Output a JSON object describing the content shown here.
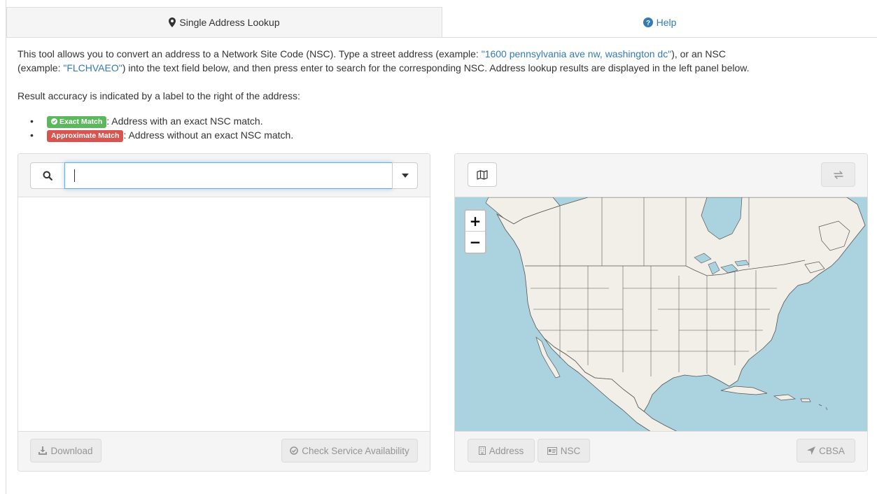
{
  "tabs": [
    {
      "label": "Single Address Lookup",
      "icon": "map-marker-icon",
      "active": true
    },
    {
      "label": "Help",
      "icon": "question-circle-icon",
      "active": false
    }
  ],
  "intro": {
    "t1": "This tool allows you to convert an address to a Network Site Code (NSC). Type a street address (example: ",
    "example_address": "\"1600 pennsylvania ave nw, washington dc\"",
    "t2": "), or an NSC",
    "t3": "(example: ",
    "example_nsc": "\"FLCHVAEO\"",
    "t4": ") into the text field below, and then press enter to search for the corresponding NSC. Address lookup results are displayed in the left panel below."
  },
  "accuracy_text": "Result accuracy is indicated by a label to the right of the address:",
  "legend": [
    {
      "badge": "Exact Match",
      "color": "#5cb85c",
      "desc": ": Address with an exact NSC match."
    },
    {
      "badge": "Approximate Match",
      "color": "#d9534f",
      "desc": ": Address without an exact NSC match."
    }
  ],
  "search": {
    "value": "",
    "placeholder": ""
  },
  "left_footer": {
    "download": "Download",
    "check": "Check Service Availability"
  },
  "map": {
    "zoom_in": "+",
    "zoom_out": "−",
    "water_color": "#aad3df",
    "land_color": "#f2efe9"
  },
  "right_footer": {
    "address": "Address",
    "nsc": "NSC",
    "cbsa": "CBSA"
  },
  "colors": {
    "link": "#337ab7",
    "focus": "#66afe9"
  }
}
